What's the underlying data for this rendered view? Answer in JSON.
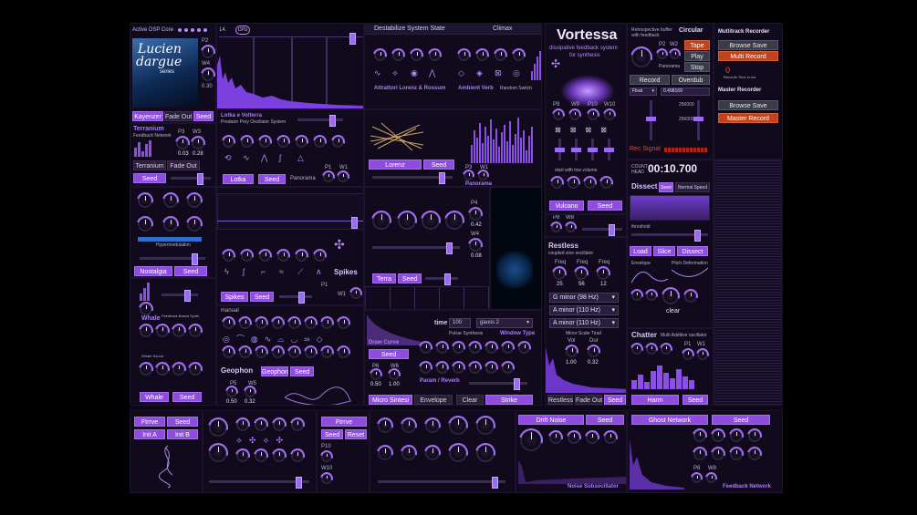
{
  "top": {
    "dsp_label": "Active DSP Core",
    "cpu_count": "14.",
    "cpu_label": "CPU",
    "destabilize": "Destabilize System State",
    "climax": "Climax"
  },
  "logo": {
    "line1": "Lucien",
    "line2": "dargue",
    "line3": "series",
    "p2": "P2",
    "w4": "W4",
    "val": "0.30"
  },
  "lucien_buttons": {
    "kayenzer": "Kayenzer",
    "fade_out": "Fade Out",
    "seed": "Seed"
  },
  "terranium": {
    "title": "Terranium",
    "sub": "Feedback Network",
    "p3": "P3",
    "w3": "W3",
    "v1": "0.03",
    "v2": "0.28",
    "btn1": "Terranium",
    "btn2": "Fade Out",
    "seed": "Seed"
  },
  "lotka": {
    "title": "Lotka e Volterra",
    "sub": "Predator Prey Oscillator System",
    "btn": "Lotka",
    "seed": "Seed",
    "panorama": "Panorama",
    "p1": "P1",
    "w1": "W1",
    "v1": "0.18",
    "v2": "0.18"
  },
  "attrattori": {
    "title": "Attrattori Lorenz & Rossum",
    "ambient": "Ambient Verb",
    "random_switch": "Random Switch",
    "lorenz": "Lorenz",
    "seed": "Seed",
    "p3": "P3",
    "w1": "W1",
    "panorama": "Panorama"
  },
  "nostalgia": {
    "hyper": "Hypermodulation",
    "btn": "Nostalgia",
    "seed": "Seed"
  },
  "spikes": {
    "title": "Spikes",
    "btn": "Spikes",
    "seed": "Seed",
    "p1": "P1",
    "w1": "W1",
    "v": "0.18"
  },
  "terra": {
    "btn": "Terra",
    "seed": "Seed",
    "p4": "P4",
    "w4": "W4",
    "v1": "0.42",
    "v2": "0.08"
  },
  "whale": {
    "title": "Whale",
    "sub": "Feedback Based Synth",
    "sub2": "Whale Sound",
    "btn": "Whale",
    "seed": "Seed"
  },
  "geophon": {
    "manual": "manual",
    "title": "Geophon",
    "btn": "Geophon",
    "seed": "Seed",
    "p5": "P5",
    "w5": "W5",
    "v1": "0.50",
    "v2": "0.32"
  },
  "micro": {
    "time": "time",
    "time_val": "100",
    "window": "gauss 2",
    "window_label": "Window Type",
    "pulsar": "Pulsar Synthesis",
    "draw": "Draw Curve",
    "seed": "Seed",
    "p6": "P6",
    "w6": "W6",
    "v1": "0.50",
    "v2": "1.00",
    "param": "Param / Reverb",
    "btn1": "Micro Sintesi",
    "btn2": "Envelope",
    "btn3": "Clear",
    "btn4": "Strike"
  },
  "vortessa": {
    "title": "Vortessa",
    "sub1": "dissipative feedback system",
    "sub2": "for synthesis",
    "p9": "P9",
    "w9": "W9",
    "p10": "P10",
    "w10": "W10",
    "start": "start with low volume",
    "btn": "Vulcano",
    "seed": "Seed",
    "p8": "P8",
    "w8": "W8"
  },
  "restless": {
    "title": "Restless",
    "sub": "coupled sine oscillator",
    "f1": "Freq",
    "f2": "Freq",
    "f3": "Freq",
    "v1": "25",
    "v2": "56",
    "v3": "12",
    "o1": "G minor (98 Hz)",
    "o2": "A minor (110 Hz)",
    "o3": "A minor (110 Hz)",
    "scale": "Minor Scale Triad",
    "vol": "Vol",
    "dur": "Dur",
    "vol_v": "1.00",
    "dur_v": "0.32",
    "btn1": "Restless",
    "btn2": "Fade Out",
    "seed": "Seed"
  },
  "buffer": {
    "label1": "Retrospective buffer",
    "label2": "with feedback",
    "p2": "P2",
    "w2": "W2",
    "panorama": "Panorama",
    "circular": "Circular",
    "tape": "Tape",
    "play": "Play",
    "stop": "Stop",
    "record": "Record",
    "overdub": "Overdub",
    "float": "Float",
    "float_v": "0.498169",
    "v256a": "256000",
    "v256b": "256000",
    "rec_signal": "Rec Signal"
  },
  "multitrack": {
    "title": "Mutlitrack Recorder",
    "browse": "Browse Save",
    "multi": "Multi Record",
    "rec_count": "0",
    "rec_label": "Records Time in ms",
    "master": "Master Recorder",
    "browse2": "Browse Save",
    "master_rec": "Master Record"
  },
  "clock": {
    "label1": "COUNT",
    "label2": "HEAD",
    "time": "00:10.700"
  },
  "dissect": {
    "title": "Dissect",
    "seed": "Seed",
    "normal": "Normal Speed",
    "threshold": "threshold",
    "load": "Load",
    "slice": "Slice",
    "dissect": "Dissect",
    "envelope": "Envelope",
    "pitch": "Pitch Deformation",
    "clear": "clear"
  },
  "chatter": {
    "title": "Chatter",
    "sub": "Multi Additive oscillator",
    "p1": "P1",
    "w1": "W1",
    "harm": "Harm",
    "seed": "Seed"
  },
  "bottom": {
    "ftrrve": "Ftrrve",
    "seed": "Seed",
    "init_a": "Init A",
    "init_b": "Init B",
    "ftrrve2": "Ftrrve",
    "seed2": "Seed",
    "reset": "Reset",
    "p10": "P10",
    "w10": "W10",
    "drift": "Drift Noise",
    "drift_seed": "Seed",
    "noise_sub": "Noise Subsocillator",
    "ghost": "Ghost Network",
    "ghost_seed": "Seed",
    "p8": "P8",
    "w8": "W8",
    "fb_net": "Feedback Network"
  }
}
